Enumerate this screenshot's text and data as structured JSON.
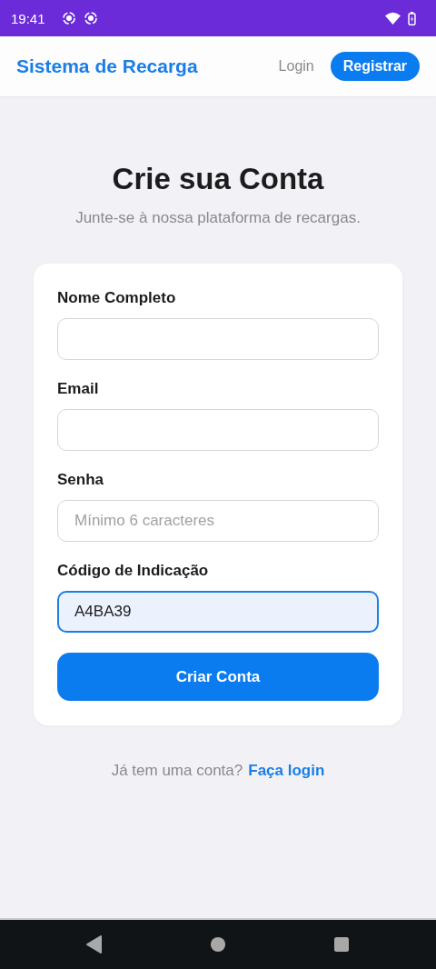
{
  "status_bar": {
    "time": "19:41"
  },
  "header": {
    "brand": "Sistema de Recarga",
    "links": [
      {
        "label": "Login",
        "selected": false
      },
      {
        "label": "Registrar",
        "selected": true
      }
    ]
  },
  "page": {
    "title": "Crie sua Conta",
    "subtitle": "Junte-se à nossa plataforma de recargas."
  },
  "form": {
    "fields": [
      {
        "label": "Nome Completo",
        "focused": false
      },
      {
        "label": "Email",
        "focused": false
      },
      {
        "label": "Senha",
        "placeholder": "Mínimo 6 caracteres",
        "focused": false
      },
      {
        "label": "Código de Indicação",
        "value": "A4BA39",
        "focused": true
      }
    ],
    "submit": "Criar Conta"
  },
  "footer": {
    "text": "Já tem uma conta?",
    "link": "Faça login"
  }
}
